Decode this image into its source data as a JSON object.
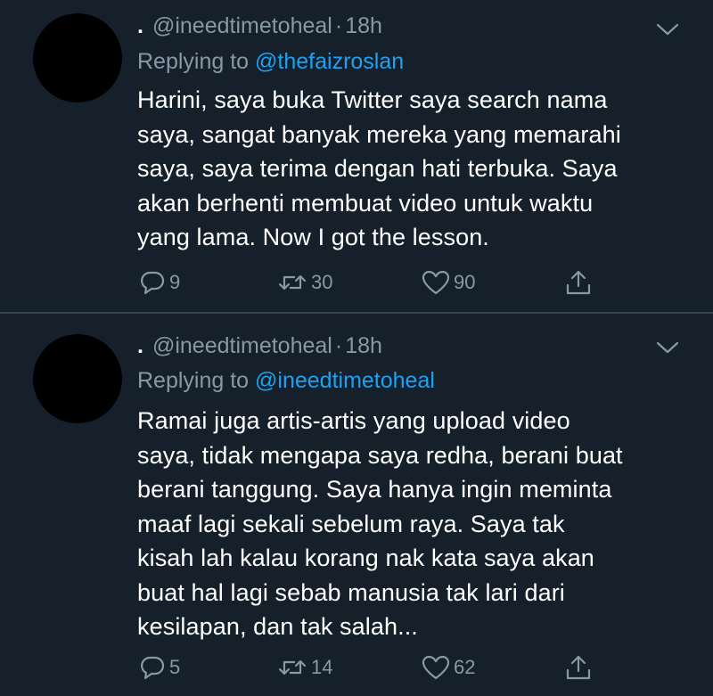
{
  "tweets": [
    {
      "display_name": ".",
      "handle": "@ineedtimetoheal",
      "separator": "·",
      "time": "18h",
      "replying_prefix": "Replying to",
      "replying_to": "@thefaizroslan",
      "text_lines": [
        "Harini, saya buka Twitter saya search nama",
        "saya, sangat banyak mereka yang memarahi",
        "saya, saya terima dengan hati terbuka. Saya",
        "akan berhenti membuat video untuk waktu",
        "yang lama. Now I got the lesson."
      ],
      "replies": "9",
      "retweets": "30",
      "likes": "90"
    },
    {
      "display_name": ".",
      "handle": "@ineedtimetoheal",
      "separator": "·",
      "time": "18h",
      "replying_prefix": "Replying to",
      "replying_to": "@ineedtimetoheal",
      "text_lines": [
        "Ramai juga artis-artis yang upload video",
        "saya, tidak mengapa saya redha, berani buat",
        "berani tanggung. Saya hanya ingin meminta",
        "maaf lagi sekali sebelum raya. Saya tak",
        "kisah lah kalau korang nak kata saya akan",
        "buat hal lagi sebab manusia tak lari dari",
        "kesilapan, dan tak salah..."
      ],
      "replies": "5",
      "retweets": "14",
      "likes": "62"
    }
  ],
  "icons": {
    "reply": "reply-icon",
    "retweet": "retweet-icon",
    "like": "like-icon",
    "share": "share-icon",
    "menu": "chevron-down-icon"
  },
  "colors": {
    "background": "#15202b",
    "secondary_text": "#8899a6",
    "link": "#1da1f2",
    "divider": "#38444d"
  }
}
